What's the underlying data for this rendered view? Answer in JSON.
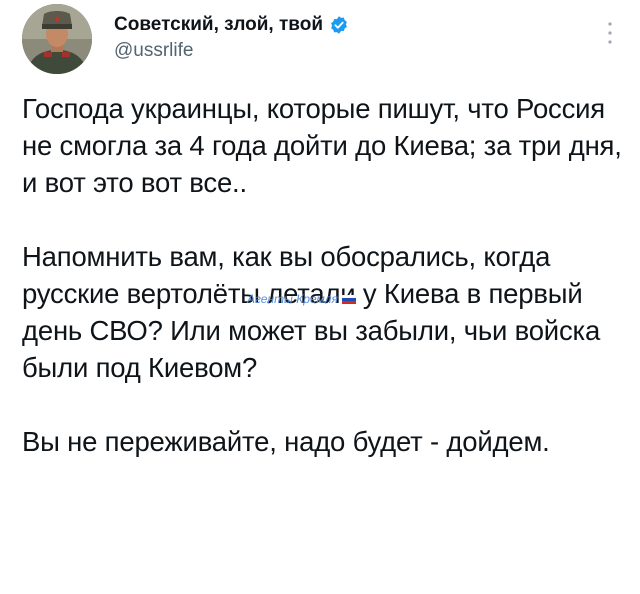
{
  "author": {
    "display_name": "Советский, злой, твой",
    "handle": "@ussrlife",
    "verified": true,
    "avatar_icon": "soldier-avatar"
  },
  "tweet": {
    "paragraphs": [
      "Господа украинцы, которые пишут, что Россия не смогла за 4 года дойти до Киева; за три дня, и вот это вот все..",
      "Напомнить вам, как вы обосрались, когда русские вертолёты летали у Киева в первый день СВО? Или может вы забыли, чьи войска были под Киевом?",
      "Вы не переживайте, надо будет - дойдем."
    ]
  },
  "watermark": {
    "text": "Агенты Кремля",
    "icon": "russian-flag-icon"
  },
  "colors": {
    "text": "#0f1419",
    "secondary": "#536471",
    "verified": "#1d9bf0",
    "watermark": "#5a8fd8"
  }
}
